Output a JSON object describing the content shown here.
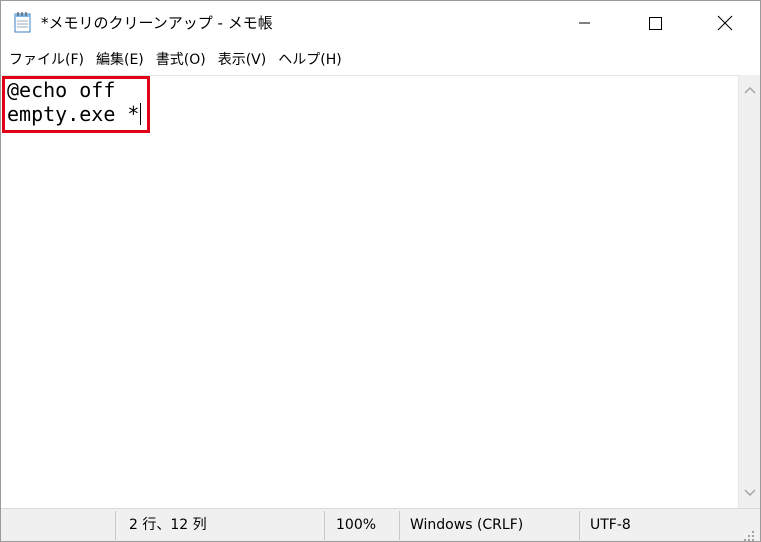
{
  "window": {
    "title": "*メモリのクリーンアップ - メモ帳",
    "app_icon": "notepad-icon",
    "caption_buttons": [
      "minimize-icon",
      "maximize-icon",
      "close-icon"
    ]
  },
  "menu": {
    "items": [
      {
        "label": "ファイル(F)"
      },
      {
        "label": "編集(E)"
      },
      {
        "label": "書式(O)"
      },
      {
        "label": "表示(V)"
      },
      {
        "label": "ヘルプ(H)"
      }
    ]
  },
  "editor": {
    "lines": [
      "@echo off",
      "empty.exe *"
    ],
    "highlight_color": "#e0001a"
  },
  "statusbar": {
    "position": "2 行、12 列",
    "zoom": "100%",
    "line_ending": "Windows (CRLF)",
    "encoding": "UTF-8"
  }
}
